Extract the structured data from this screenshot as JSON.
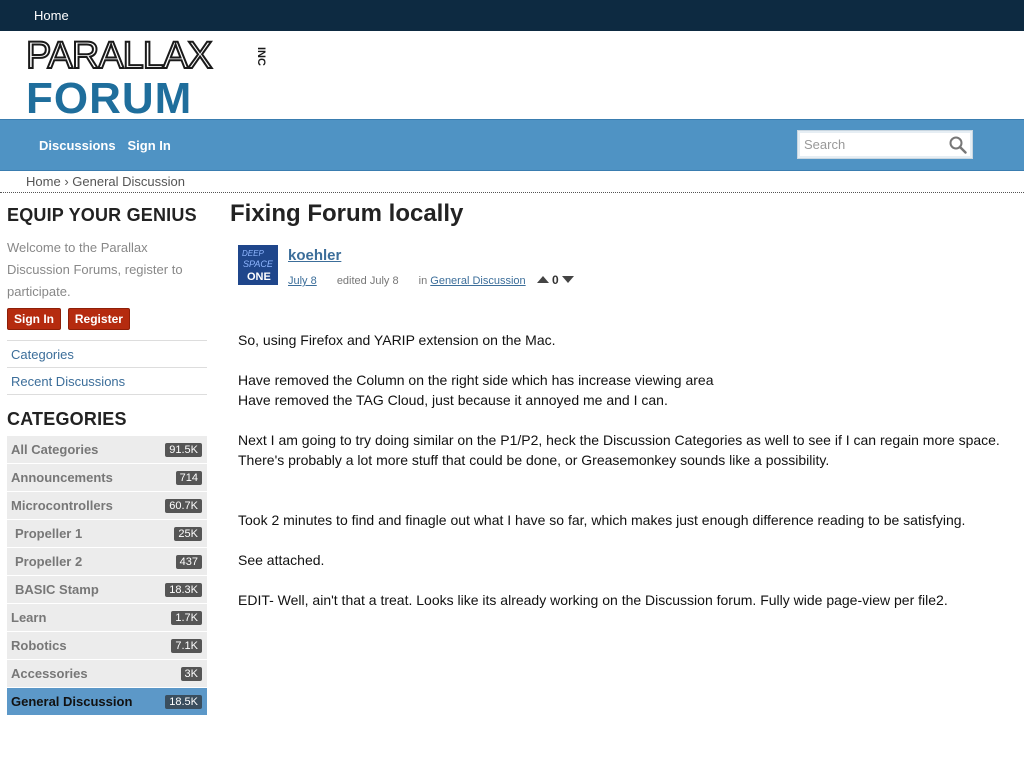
{
  "topbar": {
    "home_label": "Home"
  },
  "logo": {
    "line1": "PARALLAX",
    "line2": "FORUM",
    "suffix": "INC"
  },
  "nav": {
    "discussions": "Discussions",
    "sign_in": "Sign In"
  },
  "search": {
    "placeholder": "Search"
  },
  "breadcrumb": {
    "home": "Home",
    "sep": "›",
    "current": "General Discussion"
  },
  "sidebar": {
    "heading": "EQUIP YOUR GENIUS",
    "welcome": "Welcome to the Parallax Discussion Forums, register to participate.",
    "sign_in": "Sign In",
    "register": "Register",
    "links": [
      "Categories",
      "Recent Discussions"
    ],
    "categories_heading": "CATEGORIES",
    "categories": [
      {
        "label": "All Categories",
        "count": "91.5K"
      },
      {
        "label": "Announcements",
        "count": "714"
      },
      {
        "label": "Microcontrollers",
        "count": "60.7K"
      },
      {
        "label": "Propeller 1",
        "count": "25K"
      },
      {
        "label": "Propeller 2",
        "count": "437"
      },
      {
        "label": "BASIC Stamp",
        "count": "18.3K"
      },
      {
        "label": "Learn",
        "count": "1.7K"
      },
      {
        "label": "Robotics",
        "count": "7.1K"
      },
      {
        "label": "Accessories",
        "count": "3K"
      },
      {
        "label": "General Discussion",
        "count": "18.5K"
      }
    ]
  },
  "post": {
    "title": "Fixing Forum locally",
    "avatar_text": [
      "DEEP",
      "SPACE",
      "ONE"
    ],
    "author": "koehler",
    "date": "July 8",
    "edited": "edited July 8",
    "in_label": "in",
    "category": "General Discussion",
    "score": "0",
    "paragraphs": [
      "So, using Firefox and YARIP extension on the Mac.",
      "Have removed the Column on the right side which has increase viewing area",
      "Have removed the TAG Cloud, just because it annoyed me and I can.",
      "Next I am going to try doing similar on the P1/P2, heck the Discussion Categories as well to see if I can regain more space.",
      "There's probably a lot more stuff that could be done, or Greasemonkey sounds like a possibility.",
      "Took 2 minutes to find and finagle out what I have so far, which makes just enough difference reading to be satisfying.",
      "See attached.",
      "EDIT- Well, ain't that a treat.  Looks like its already working on the Discussion forum.  Fully wide page-view per file2."
    ]
  }
}
